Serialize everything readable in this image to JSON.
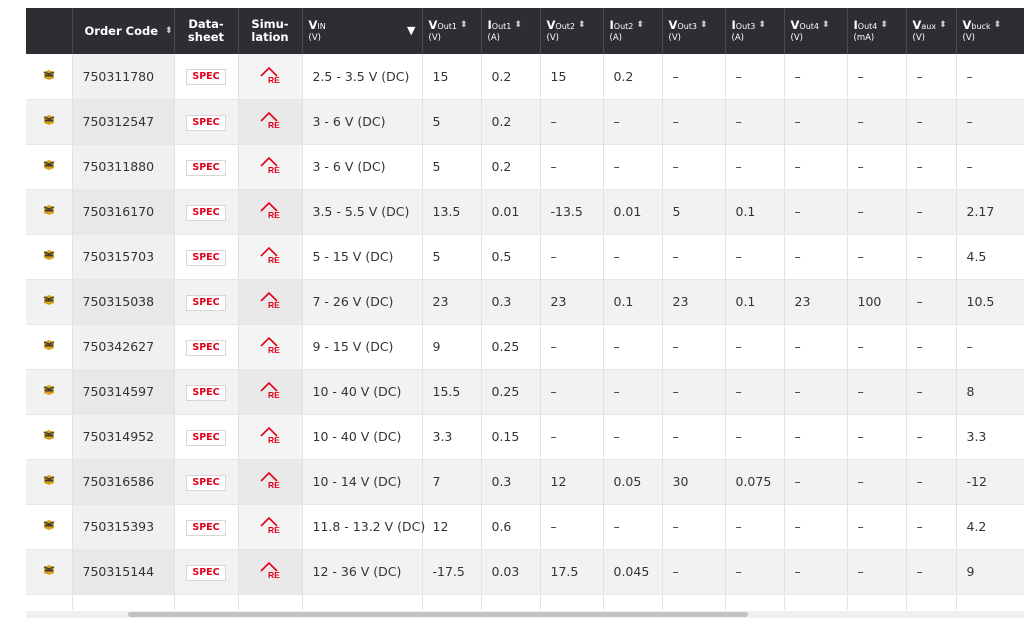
{
  "header": {
    "order_code": "Order Code",
    "datasheet_1": "Data-",
    "datasheet_2": "sheet",
    "simulation_1": "Simu-",
    "simulation_2": "lation",
    "vin_main": "V",
    "vin_sub": "IN",
    "vin_unit": "(V)",
    "vout1_main": "V",
    "vout1_sub": "Out1",
    "vout1_unit": "(V)",
    "iout1_main": "I",
    "iout1_sub": "Out1",
    "iout1_unit": "(A)",
    "vout2_main": "V",
    "vout2_sub": "Out2",
    "vout2_unit": "(V)",
    "iout2_main": "I",
    "iout2_sub": "Out2",
    "iout2_unit": "(A)",
    "vout3_main": "V",
    "vout3_sub": "Out3",
    "vout3_unit": "(V)",
    "iout3_main": "I",
    "iout3_sub": "Out3",
    "iout3_unit": "(A)",
    "vout4_main": "V",
    "vout4_sub": "Out4",
    "vout4_unit": "(V)",
    "iout4_main": "I",
    "iout4_sub": "Out4",
    "iout4_unit": "(mA)",
    "vaux_main": "V",
    "vaux_sub": "aux",
    "vaux_unit": "(V)",
    "vbuck_main": "V",
    "vbuck_sub": "buck",
    "vbuck_unit": "(V)",
    "sort_glyph": "⬍",
    "dropdown_glyph": "▼"
  },
  "spec_label": "SPEC",
  "sim_label": "RE",
  "colors": {
    "header_bg": "#2d2d33",
    "spec_red": "#e2001a",
    "part_gold": "#d9a21b"
  },
  "rows": [
    {
      "code": "750311780",
      "vin": "2.5 - 3.5 V (DC)",
      "vout1": "15",
      "iout1": "0.2",
      "vout2": "15",
      "iout2": "0.2",
      "vout3": "–",
      "iout3": "–",
      "vout4": "–",
      "iout4": "–",
      "vaux": "–",
      "vbuck": "–"
    },
    {
      "code": "750312547",
      "vin": "3 - 6 V (DC)",
      "vout1": "5",
      "iout1": "0.2",
      "vout2": "–",
      "iout2": "–",
      "vout3": "–",
      "iout3": "–",
      "vout4": "–",
      "iout4": "–",
      "vaux": "–",
      "vbuck": "–"
    },
    {
      "code": "750311880",
      "vin": "3 - 6 V (DC)",
      "vout1": "5",
      "iout1": "0.2",
      "vout2": "–",
      "iout2": "–",
      "vout3": "–",
      "iout3": "–",
      "vout4": "–",
      "iout4": "–",
      "vaux": "–",
      "vbuck": "–"
    },
    {
      "code": "750316170",
      "vin": "3.5 - 5.5 V (DC)",
      "vout1": "13.5",
      "iout1": "0.01",
      "vout2": "-13.5",
      "iout2": "0.01",
      "vout3": "5",
      "iout3": "0.1",
      "vout4": "–",
      "iout4": "–",
      "vaux": "–",
      "vbuck": "2.17"
    },
    {
      "code": "750315703",
      "vin": "5 - 15 V (DC)",
      "vout1": "5",
      "iout1": "0.5",
      "vout2": "–",
      "iout2": "–",
      "vout3": "–",
      "iout3": "–",
      "vout4": "–",
      "iout4": "–",
      "vaux": "–",
      "vbuck": "4.5"
    },
    {
      "code": "750315038",
      "vin": "7 - 26 V (DC)",
      "vout1": "23",
      "iout1": "0.3",
      "vout2": "23",
      "iout2": "0.1",
      "vout3": "23",
      "iout3": "0.1",
      "vout4": "23",
      "iout4": "100",
      "vaux": "–",
      "vbuck": "10.5"
    },
    {
      "code": "750342627",
      "vin": "9 - 15 V (DC)",
      "vout1": "9",
      "iout1": "0.25",
      "vout2": "–",
      "iout2": "–",
      "vout3": "–",
      "iout3": "–",
      "vout4": "–",
      "iout4": "–",
      "vaux": "–",
      "vbuck": "–"
    },
    {
      "code": "750314597",
      "vin": "10 - 40 V (DC)",
      "vout1": "15.5",
      "iout1": "0.25",
      "vout2": "–",
      "iout2": "–",
      "vout3": "–",
      "iout3": "–",
      "vout4": "–",
      "iout4": "–",
      "vaux": "–",
      "vbuck": "8"
    },
    {
      "code": "750314952",
      "vin": "10 - 40 V (DC)",
      "vout1": "3.3",
      "iout1": "0.15",
      "vout2": "–",
      "iout2": "–",
      "vout3": "–",
      "iout3": "–",
      "vout4": "–",
      "iout4": "–",
      "vaux": "–",
      "vbuck": "3.3"
    },
    {
      "code": "750316586",
      "vin": "10 - 14 V (DC)",
      "vout1": "7",
      "iout1": "0.3",
      "vout2": "12",
      "iout2": "0.05",
      "vout3": "30",
      "iout3": "0.075",
      "vout4": "–",
      "iout4": "–",
      "vaux": "–",
      "vbuck": "-12"
    },
    {
      "code": "750315393",
      "vin": "11.8 - 13.2 V (DC)",
      "vout1": "12",
      "iout1": "0.6",
      "vout2": "–",
      "iout2": "–",
      "vout3": "–",
      "iout3": "–",
      "vout4": "–",
      "iout4": "–",
      "vaux": "–",
      "vbuck": "4.2"
    },
    {
      "code": "750315144",
      "vin": "12 - 36 V (DC)",
      "vout1": "-17.5",
      "iout1": "0.03",
      "vout2": "17.5",
      "iout2": "0.045",
      "vout3": "–",
      "iout3": "–",
      "vout4": "–",
      "iout4": "–",
      "vaux": "–",
      "vbuck": "9"
    }
  ]
}
